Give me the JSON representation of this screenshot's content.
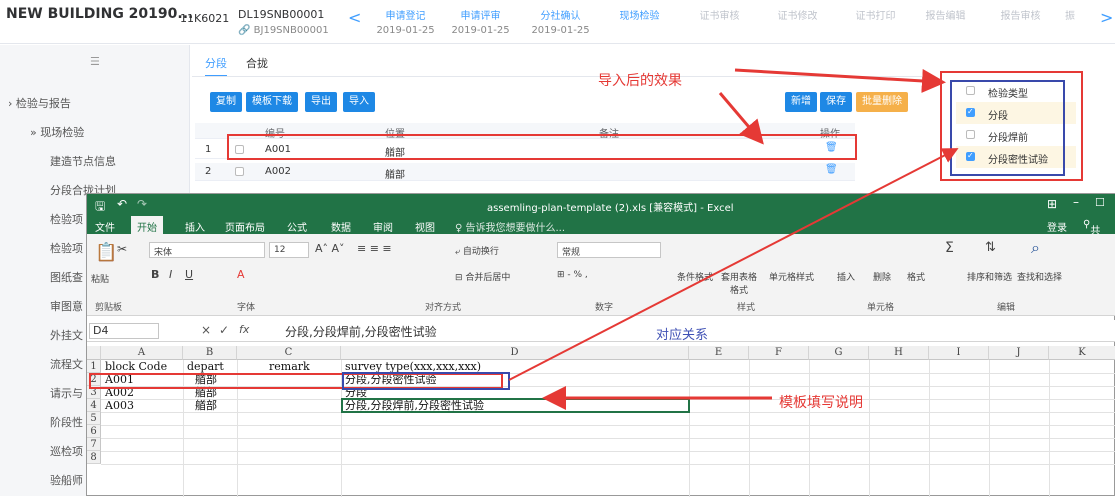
{
  "topbar": {
    "project": "NEW BUILDING 20190...",
    "code1": "11K6021",
    "code2": "DL19SNB00001",
    "code2_sub": "BJ19SNB00001",
    "chevron": "<",
    "chevron_right": ">",
    "steps": [
      {
        "label": "申请登记",
        "date": "2019-01-25",
        "active": true
      },
      {
        "label": "申请评审",
        "date": "2019-01-25",
        "active": true
      },
      {
        "label": "分社确认",
        "date": "2019-01-25",
        "active": true
      },
      {
        "label": "现场检验",
        "date": "",
        "active": true
      },
      {
        "label": "证书审核",
        "date": "",
        "active": false
      },
      {
        "label": "证书修改",
        "date": "",
        "active": false
      },
      {
        "label": "证书打印",
        "date": "",
        "active": false
      },
      {
        "label": "报告编辑",
        "date": "",
        "active": false
      },
      {
        "label": "报告审核",
        "date": "",
        "active": false
      },
      {
        "label": "振",
        "date": "",
        "active": false
      }
    ]
  },
  "sidebar": {
    "items": [
      {
        "label": "检验与报告"
      },
      {
        "label": "现场检验"
      },
      {
        "label": "建造节点信息"
      },
      {
        "label": "分段合拢计划"
      },
      {
        "label": "检验项"
      },
      {
        "label": "检验项"
      },
      {
        "label": "图纸查"
      },
      {
        "label": "审图意"
      },
      {
        "label": "外挂文"
      },
      {
        "label": "流程文"
      },
      {
        "label": "请示与"
      },
      {
        "label": "阶段性"
      },
      {
        "label": "巡检项"
      },
      {
        "label": "验船师"
      }
    ]
  },
  "tabs": [
    {
      "label": "分段"
    },
    {
      "label": "合拢"
    }
  ],
  "toolbar": {
    "copy": "复制",
    "template_download": "模板下载",
    "export": "导出",
    "import": "导入",
    "add": "新增",
    "save": "保存",
    "batch_delete": "批量删除"
  },
  "table": {
    "headers": [
      "编号",
      "位置",
      "备注",
      "操作"
    ],
    "rows": [
      {
        "num": "1",
        "code": "A001",
        "location": "艏部",
        "remark": ""
      },
      {
        "num": "2",
        "code": "A002",
        "location": "艏部",
        "remark": ""
      }
    ]
  },
  "panel": {
    "items": [
      {
        "label": "检验类型",
        "checked": false
      },
      {
        "label": "分段",
        "checked": true
      },
      {
        "label": "分段焊前",
        "checked": false
      },
      {
        "label": "分段密性试验",
        "checked": true
      }
    ]
  },
  "annotations": {
    "import_effect": "导入后的效果",
    "mapping": "对应关系",
    "template_note": "模板填写说明"
  },
  "excel": {
    "title": "assemling-plan-template (2).xls  [兼容模式] - Excel",
    "menu": [
      "文件",
      "开始",
      "插入",
      "页面布局",
      "公式",
      "数据",
      "审阅",
      "视图"
    ],
    "tell_me": "♀ 告诉我您想要做什么...",
    "login": "登录",
    "share": "共享",
    "ribbon": {
      "paste": "粘贴",
      "clipboard": "剪贴板",
      "font_name": "宋体",
      "font_size": "12",
      "font": "字体",
      "wrap": "自动换行",
      "merge": "合并后居中",
      "align": "对齐方式",
      "number_format": "常规",
      "number": "数字",
      "cond_format": "条件格式",
      "table_format": "套用表格格式",
      "cell_style": "单元格样式",
      "styles": "样式",
      "insert": "插入",
      "delete": "删除",
      "format": "格式",
      "cells": "单元格",
      "sort_filter": "排序和筛选",
      "find_select": "查找和选择",
      "edit": "编辑"
    },
    "name_box": "D4",
    "formula": "分段,分段焊前,分段密性试验",
    "columns": [
      "A",
      "B",
      "C",
      "D",
      "E",
      "F",
      "G",
      "H",
      "I",
      "J",
      "K"
    ],
    "rows": [
      {
        "n": "1",
        "a": "block Code",
        "b": "depart",
        "c": "remark",
        "d": "survey type(xxx,xxx,xxx)"
      },
      {
        "n": "2",
        "a": "A001",
        "b": "艏部",
        "c": "",
        "d": "分段,分段密性试验"
      },
      {
        "n": "3",
        "a": "A002",
        "b": "艏部",
        "c": "",
        "d": "分段"
      },
      {
        "n": "4",
        "a": "A003",
        "b": "艏部",
        "c": "",
        "d": "分段,分段焊前,分段密性试验"
      },
      {
        "n": "5",
        "a": "",
        "b": "",
        "c": "",
        "d": ""
      },
      {
        "n": "6",
        "a": "",
        "b": "",
        "c": "",
        "d": ""
      },
      {
        "n": "7",
        "a": "",
        "b": "",
        "c": "",
        "d": ""
      },
      {
        "n": "8",
        "a": "",
        "b": "",
        "c": "",
        "d": ""
      }
    ]
  },
  "colors": {
    "primary": "#409eff",
    "excel_green": "#217346",
    "annotation_red": "#e53935",
    "annotation_blue": "#3949ab"
  }
}
